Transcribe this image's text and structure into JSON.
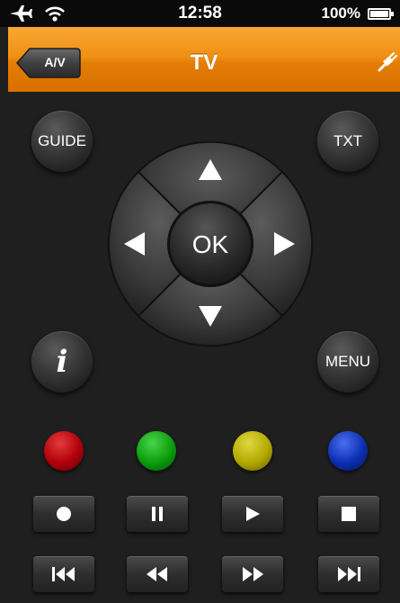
{
  "status_bar": {
    "time": "12:58",
    "battery": "100%"
  },
  "nav": {
    "back_label": "A/V",
    "title": "TV"
  },
  "remote": {
    "guide_label": "GUIDE",
    "txt_label": "TXT",
    "ok_label": "OK",
    "info_label": "i",
    "menu_label": "MENU"
  },
  "colors": {
    "nav_orange": "#f09015",
    "background": "#1f1f1f",
    "red_button": "#b0000b",
    "green_button": "#0a9d0c",
    "yellow_button": "#b3a900",
    "blue_button": "#0b2fb0"
  },
  "icons": [
    "airplane-icon",
    "wifi-icon",
    "battery-icon",
    "plug-icon",
    "record-icon",
    "pause-icon",
    "play-icon",
    "stop-icon",
    "skip-back-icon",
    "rewind-icon",
    "fast-forward-icon",
    "skip-forward-icon"
  ]
}
